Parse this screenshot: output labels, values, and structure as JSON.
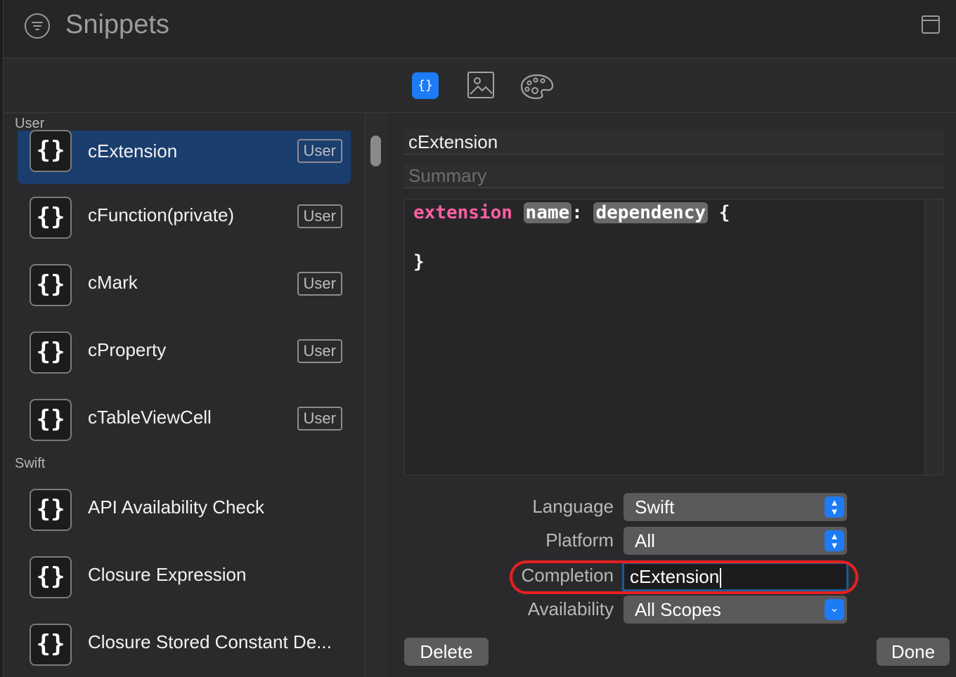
{
  "window": {
    "title": "Snippets"
  },
  "toolbar": {
    "tabs": [
      {
        "icon": "code-snippet-icon",
        "glyph": "{}",
        "active": true
      },
      {
        "icon": "media-image-icon",
        "active": false
      },
      {
        "icon": "color-palette-icon",
        "active": false
      }
    ]
  },
  "sidebar": {
    "sections": [
      {
        "header": "User",
        "items": [
          {
            "name": "cExtension",
            "tag": "User",
            "selected": true
          },
          {
            "name": "cFunction(private)",
            "tag": "User"
          },
          {
            "name": "cMark",
            "tag": "User"
          },
          {
            "name": "cProperty",
            "tag": "User"
          },
          {
            "name": "cTableViewCell",
            "tag": "User"
          }
        ]
      },
      {
        "header": "Swift",
        "items": [
          {
            "name": "API Availability Check"
          },
          {
            "name": "Closure Expression"
          },
          {
            "name": "Closure Stored Constant De..."
          }
        ]
      }
    ],
    "icon_glyph": "{}"
  },
  "detail": {
    "name_value": "cExtension",
    "summary_placeholder": "Summary",
    "code": {
      "keyword": "extension",
      "placeholder_1": "name",
      "colon": ":",
      "placeholder_2": "dependency",
      "open_brace": "{",
      "close_brace": "}"
    },
    "language": {
      "label": "Language",
      "value": "Swift"
    },
    "platform": {
      "label": "Platform",
      "value": "All"
    },
    "completion": {
      "label": "Completion",
      "value": "cExtension"
    },
    "availability": {
      "label": "Availability",
      "value": "All Scopes"
    },
    "delete_label": "Delete",
    "done_label": "Done"
  },
  "colors": {
    "accent": "#1c7cf6",
    "selection": "#1a3e6e",
    "keyword": "#fc5fa3",
    "highlight_ring": "#e52020"
  }
}
